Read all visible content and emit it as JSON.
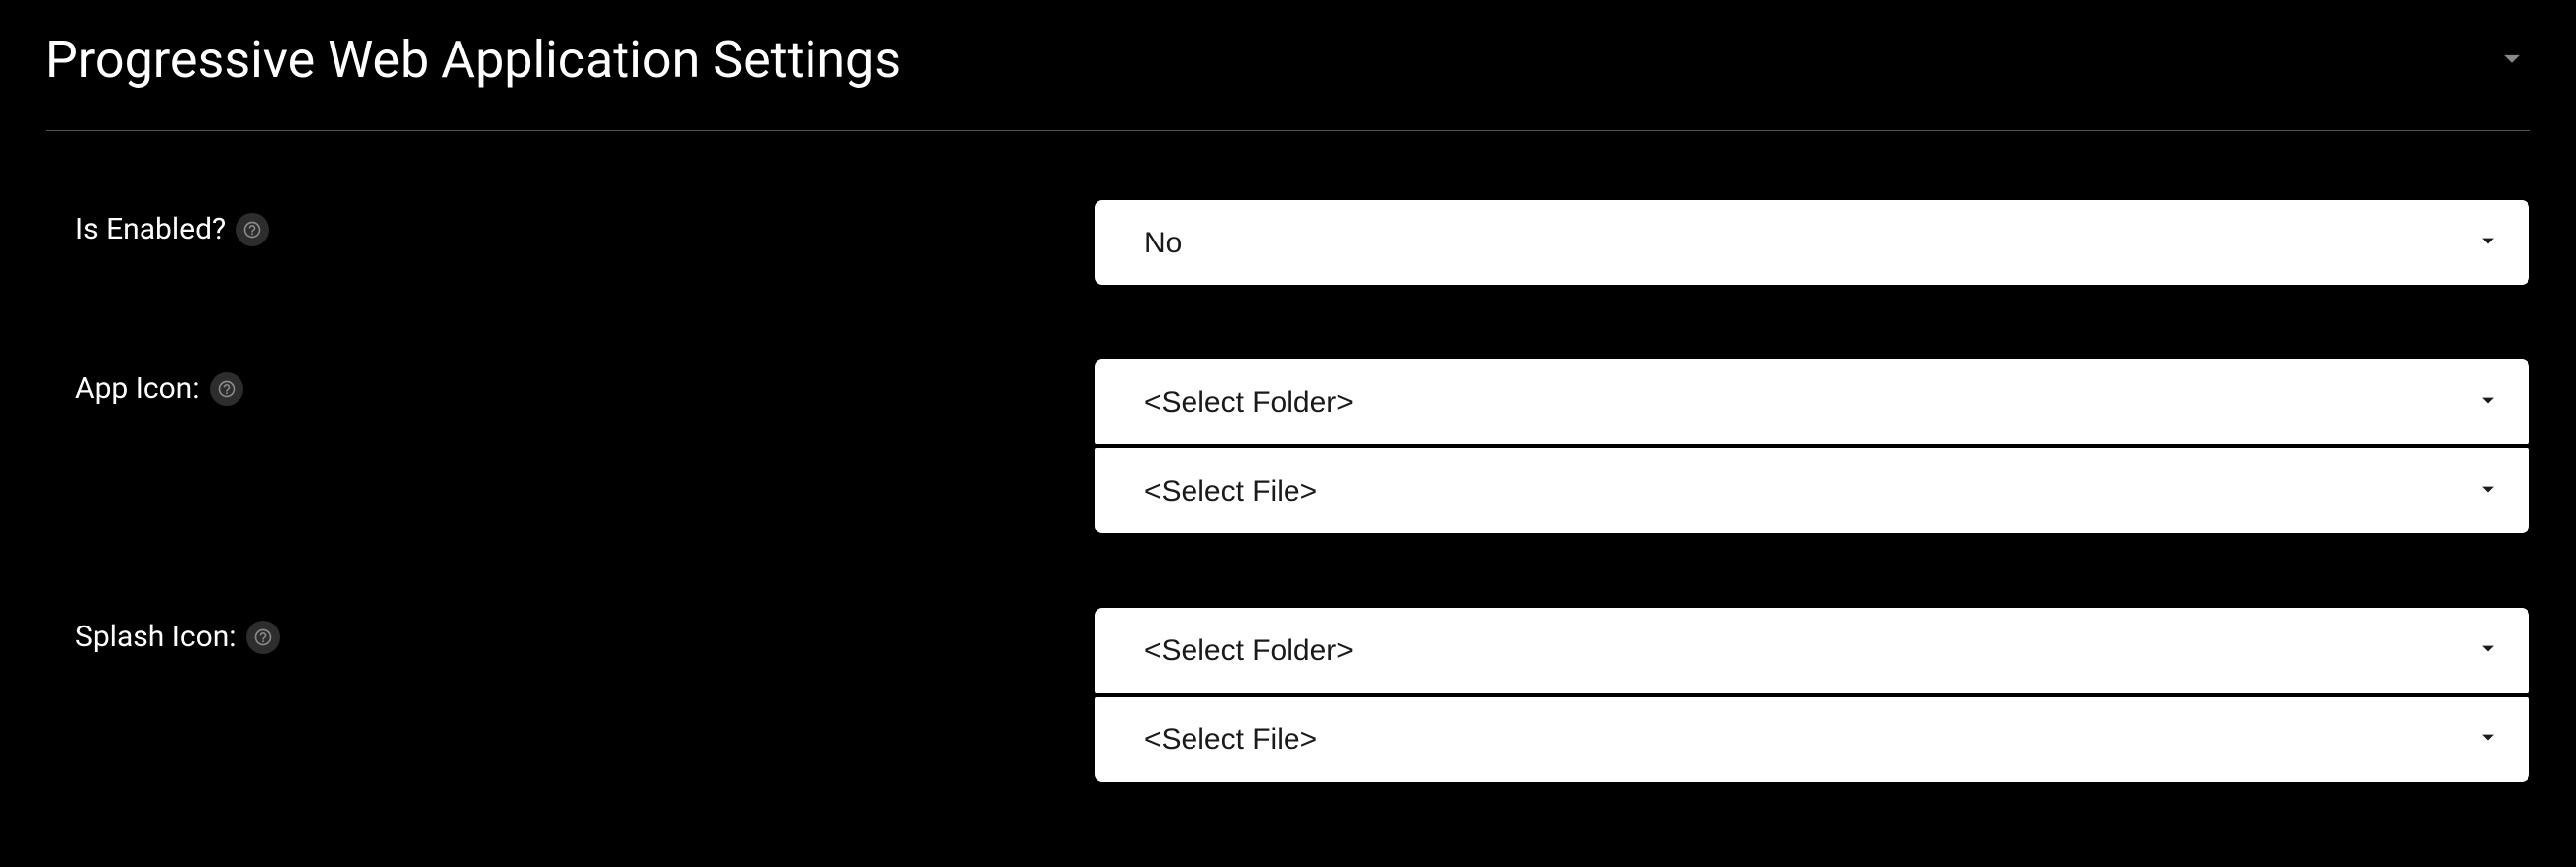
{
  "header": {
    "title": "Progressive Web Application Settings"
  },
  "rows": {
    "isEnabled": {
      "label": "Is Enabled?",
      "value": "No"
    },
    "appIcon": {
      "label": "App Icon:",
      "folderValue": "<Select Folder>",
      "fileValue": "<Select File>"
    },
    "splashIcon": {
      "label": "Splash Icon:",
      "folderValue": "<Select Folder>",
      "fileValue": "<Select File>"
    }
  }
}
